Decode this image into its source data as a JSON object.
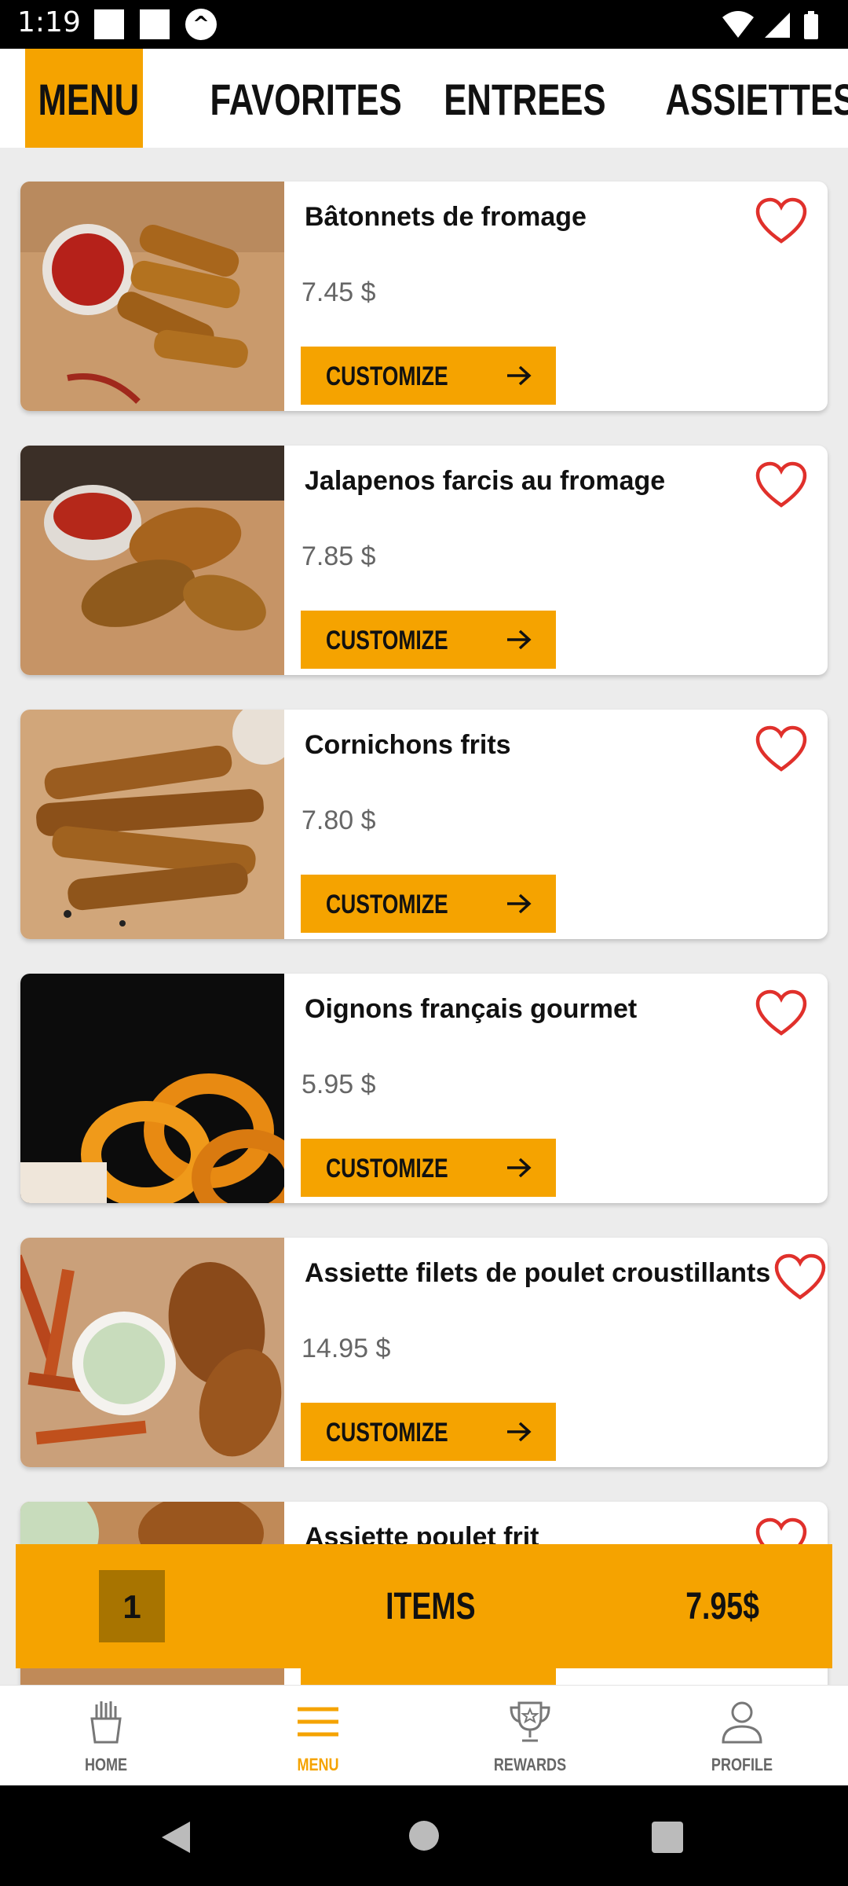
{
  "status_bar": {
    "time": "1:19"
  },
  "tabs": [
    {
      "label": "MENU",
      "active": true
    },
    {
      "label": "FAVORITES",
      "active": false
    },
    {
      "label": "ENTREES",
      "active": false
    },
    {
      "label": "ASSIETTES",
      "active": false
    }
  ],
  "menu_items": [
    {
      "name": "Bâtonnets de fromage",
      "price": "7.45 $",
      "button": "CUSTOMIZE"
    },
    {
      "name": "Jalapenos farcis au fromage",
      "price": "7.85 $",
      "button": "CUSTOMIZE"
    },
    {
      "name": "Cornichons frits",
      "price": "7.80 $",
      "button": "CUSTOMIZE"
    },
    {
      "name": "Oignons français gourmet",
      "price": "5.95 $",
      "button": "CUSTOMIZE"
    },
    {
      "name": "Assiette filets de poulet croustillants",
      "price": "14.95 $",
      "button": "CUSTOMIZE"
    },
    {
      "name": "Assiette poulet frit"
    }
  ],
  "cart": {
    "quantity": "1",
    "label": "ITEMS",
    "total": "7.95$"
  },
  "bottom_nav": [
    {
      "label": "HOME",
      "icon": "fries-icon"
    },
    {
      "label": "MENU",
      "icon": "menu-icon",
      "active": true
    },
    {
      "label": "REWARDS",
      "icon": "trophy-icon"
    },
    {
      "label": "PROFILE",
      "icon": "person-icon"
    }
  ],
  "colors": {
    "accent": "#f5a300",
    "heart": "#e0302b",
    "price_text": "#666666"
  }
}
